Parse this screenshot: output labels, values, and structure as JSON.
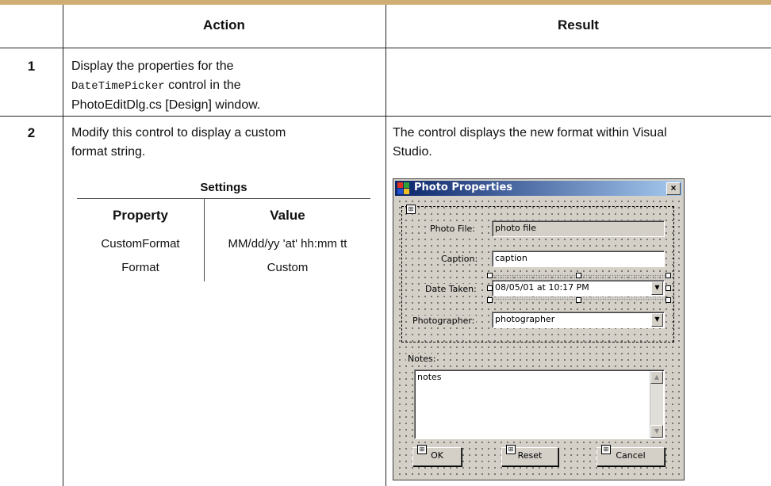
{
  "table": {
    "header_action": "Action",
    "header_result": "Result",
    "rows": [
      {
        "step": "1",
        "action_pre": "Display the properties for the",
        "action_code": "DateTimePicker",
        "action_mid": " control in the",
        "action_post": "PhotoEditDlg.cs [Design] window.",
        "result": ""
      },
      {
        "step": "2",
        "action_line1": "Modify this control to display a custom",
        "action_line2": "format string.",
        "result_line1": "The control displays the new format within Visual",
        "result_line2": "Studio."
      }
    ]
  },
  "settings": {
    "title": "Settings",
    "col_property": "Property",
    "col_value": "Value",
    "rows": [
      {
        "property": "CustomFormat",
        "value": "MM/dd/yy 'at' hh:mm tt"
      },
      {
        "property": "Format",
        "value": "Custom"
      }
    ]
  },
  "dialog": {
    "title": "Photo Properties",
    "close": "×",
    "photo_file_label": "Photo File:",
    "photo_file_value": "photo file",
    "caption_label": "Caption:",
    "caption_value": "caption",
    "date_taken_label": "Date Taken:",
    "date_taken_value": "08/05/01 at 10:17 PM",
    "photographer_label": "Photographer:",
    "photographer_value": "photographer",
    "notes_label": "Notes:",
    "notes_value": "notes",
    "ok_button": "OK",
    "reset_button": "Reset",
    "cancel_button": "Cancel",
    "dropdown_arrow": "▼",
    "scroll_up": "▲",
    "scroll_down": "▼"
  }
}
